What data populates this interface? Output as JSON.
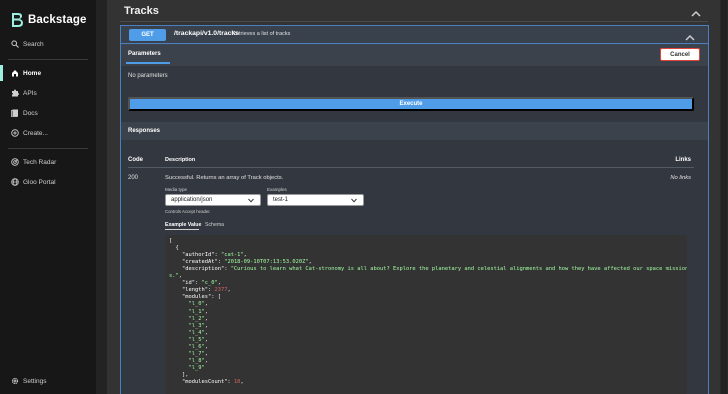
{
  "app": {
    "name": "Backstage",
    "brand_color": "#9bf0e1"
  },
  "sidebar": {
    "search": {
      "label": "Search",
      "icon": "search-icon"
    },
    "items": [
      {
        "label": "Home",
        "icon": "home-icon",
        "active": true
      },
      {
        "label": "APIs",
        "icon": "extension-icon",
        "active": false
      },
      {
        "label": "Docs",
        "icon": "docs-icon",
        "active": false
      },
      {
        "label": "Create...",
        "icon": "add-circle-icon",
        "active": false
      }
    ],
    "plugins": [
      {
        "label": "Tech Radar",
        "icon": "radar-icon"
      },
      {
        "label": "Gloo Portal",
        "icon": "globe-icon"
      }
    ],
    "settings": {
      "label": "Settings",
      "icon": "gear-icon"
    }
  },
  "section": {
    "title": "Tracks"
  },
  "operation": {
    "method": "GET",
    "path": "/trackapi/v1.0/tracks",
    "summary": "Retrieves a list of tracks",
    "method_color": "#4f9de8"
  },
  "parameters": {
    "tab_label": "Parameters",
    "cancel_label": "Cancel",
    "empty_text": "No parameters",
    "execute_label": "Execute"
  },
  "responses": {
    "title": "Responses",
    "columns": {
      "code": "Code",
      "description": "Description",
      "links": "Links"
    },
    "rows": [
      {
        "code": "200",
        "description": "Successful. Returns an array of Track objects.",
        "links": "No links",
        "media_type_label": "Media type",
        "media_type_value": "application/json",
        "controls_note": "Controls Accept header.",
        "examples_label": "Examples",
        "examples_value": "test-1"
      }
    ],
    "example_tabs": {
      "example_value": "Example Value",
      "schema": "Schema"
    }
  },
  "example_code": [
    {
      "indent": 0,
      "parts": [
        {
          "t": "p",
          "v": "["
        }
      ]
    },
    {
      "indent": 1,
      "parts": [
        {
          "t": "p",
          "v": "{"
        }
      ]
    },
    {
      "indent": 2,
      "parts": [
        {
          "t": "k",
          "v": "\"authorId\": "
        },
        {
          "t": "s",
          "v": "\"cat-1\""
        },
        {
          "t": "p",
          "v": ","
        }
      ]
    },
    {
      "indent": 2,
      "parts": [
        {
          "t": "k",
          "v": "\"createdAt\": "
        },
        {
          "t": "s",
          "v": "\"2018-09-10T07:13:53.020Z\""
        },
        {
          "t": "p",
          "v": ","
        }
      ]
    },
    {
      "indent": 2,
      "parts": [
        {
          "t": "k",
          "v": "\"description\": "
        },
        {
          "t": "s",
          "v": "\"Curious to learn what Cat-stronomy is all about? Explore the planetary and celestial alignments and how they have affected our space mission"
        }
      ]
    },
    {
      "indent": 0,
      "parts": [
        {
          "t": "s",
          "v": "s.\""
        },
        {
          "t": "p",
          "v": ","
        }
      ]
    },
    {
      "indent": 2,
      "parts": [
        {
          "t": "k",
          "v": "\"id\": "
        },
        {
          "t": "s",
          "v": "\"c_0\""
        },
        {
          "t": "p",
          "v": ","
        }
      ]
    },
    {
      "indent": 2,
      "parts": [
        {
          "t": "k",
          "v": "\"length\": "
        },
        {
          "t": "n",
          "v": "2377"
        },
        {
          "t": "p",
          "v": ","
        }
      ]
    },
    {
      "indent": 2,
      "parts": [
        {
          "t": "k",
          "v": "\"modules\": ["
        }
      ]
    },
    {
      "indent": 3,
      "parts": [
        {
          "t": "s",
          "v": "\"l_0\""
        },
        {
          "t": "p",
          "v": ","
        }
      ]
    },
    {
      "indent": 3,
      "parts": [
        {
          "t": "s",
          "v": "\"l_1\""
        },
        {
          "t": "p",
          "v": ","
        }
      ]
    },
    {
      "indent": 3,
      "parts": [
        {
          "t": "s",
          "v": "\"l_2\""
        },
        {
          "t": "p",
          "v": ","
        }
      ]
    },
    {
      "indent": 3,
      "parts": [
        {
          "t": "s",
          "v": "\"l_3\""
        },
        {
          "t": "p",
          "v": ","
        }
      ]
    },
    {
      "indent": 3,
      "parts": [
        {
          "t": "s",
          "v": "\"l_4\""
        },
        {
          "t": "p",
          "v": ","
        }
      ]
    },
    {
      "indent": 3,
      "parts": [
        {
          "t": "s",
          "v": "\"l_5\""
        },
        {
          "t": "p",
          "v": ","
        }
      ]
    },
    {
      "indent": 3,
      "parts": [
        {
          "t": "s",
          "v": "\"l_6\""
        },
        {
          "t": "p",
          "v": ","
        }
      ]
    },
    {
      "indent": 3,
      "parts": [
        {
          "t": "s",
          "v": "\"l_7\""
        },
        {
          "t": "p",
          "v": ","
        }
      ]
    },
    {
      "indent": 3,
      "parts": [
        {
          "t": "s",
          "v": "\"l_8\""
        },
        {
          "t": "p",
          "v": ","
        }
      ]
    },
    {
      "indent": 3,
      "parts": [
        {
          "t": "s",
          "v": "\"l_9\""
        }
      ]
    },
    {
      "indent": 2,
      "parts": [
        {
          "t": "p",
          "v": "],"
        }
      ]
    },
    {
      "indent": 2,
      "parts": [
        {
          "t": "k",
          "v": "\"modulesCount\": "
        },
        {
          "t": "n",
          "v": "10"
        },
        {
          "t": "p",
          "v": ","
        }
      ]
    }
  ]
}
